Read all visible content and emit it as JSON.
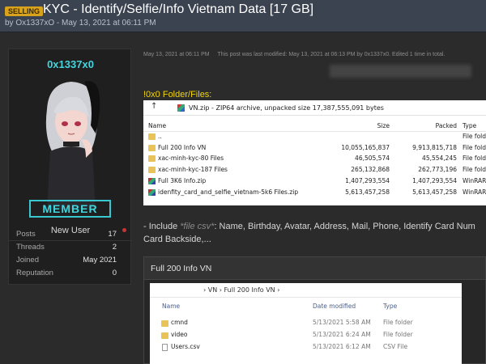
{
  "thread": {
    "badge": "SELLING",
    "title": "KYC - Identify/Selfie/Info Vietnam Data [17 GB]",
    "byline": "by Ox1337xO - May 13, 2021 at 06:11 PM"
  },
  "user": {
    "name": "0x1337x0",
    "role": "New User",
    "rank": "MEMBER",
    "stats": [
      {
        "label": "Posts",
        "value": "17"
      },
      {
        "label": "Threads",
        "value": "2"
      },
      {
        "label": "Joined",
        "value": "May 2021"
      },
      {
        "label": "Reputation",
        "value": "0"
      }
    ]
  },
  "post": {
    "date": "May 13, 2021 at 06:11 PM",
    "edit_note": "This post was last modified: May 13, 2021 at 06:13 PM by 0x1337x0. Edited 1 time in total.",
    "folder_heading": "!0x0 Folder/Files:",
    "include_prefix": "- Include ",
    "include_em": "*file csv*",
    "include_rest": ": Name, Birthday, Avatar, Address, Mail, Phone, Identify Card Num",
    "include_line2": "Card Backside,..."
  },
  "archive": {
    "path": "VN.zip - ZIP64 archive, unpacked size 17,387,555,091 bytes",
    "columns": {
      "name": "Name",
      "size": "Size",
      "packed": "Packed",
      "type": "Type"
    },
    "rows": [
      {
        "name": "..",
        "size": "",
        "packed": "",
        "type": "File folde",
        "icon": "folder-icon"
      },
      {
        "name": "Full 200 Info VN",
        "size": "10,055,165,837",
        "packed": "9,913,815,718",
        "type": "File folde",
        "icon": "folder-icon"
      },
      {
        "name": "xac-minh-kyc-80 Files",
        "size": "46,505,574",
        "packed": "45,554,245",
        "type": "File folde",
        "icon": "folder-icon"
      },
      {
        "name": "xac-minh-kyc-187 Files",
        "size": "265,132,868",
        "packed": "262,773,196",
        "type": "File folde",
        "icon": "folder-icon"
      },
      {
        "name": "Full 3K6 Info.zip",
        "size": "1,407,293,554",
        "packed": "1,407,293,554",
        "type": "WinRAR",
        "icon": "rar-icon"
      },
      {
        "name": "idenfity_card_and_selfie_vietnam-5k6 Files.zip",
        "size": "5,613,457,258",
        "packed": "5,613,457,258",
        "type": "WinRAR",
        "icon": "rar-icon"
      }
    ]
  },
  "spoiler": {
    "title": "Full 200 Info VN",
    "crumbs": "›  VN  ›  Full 200 Info VN  ›",
    "columns": {
      "name": "Name",
      "date": "Date modified",
      "type": "Type"
    },
    "rows": [
      {
        "name": "cmnd",
        "date": "5/13/2021 5:58 AM",
        "type": "File folder",
        "icon": "folder-icon"
      },
      {
        "name": "video",
        "date": "5/13/2021 6:24 AM",
        "type": "File folder",
        "icon": "folder-icon"
      },
      {
        "name": "Users.csv",
        "date": "5/13/2021 6:12 AM",
        "type": "CSV File",
        "icon": "csv-file-icon"
      }
    ]
  }
}
